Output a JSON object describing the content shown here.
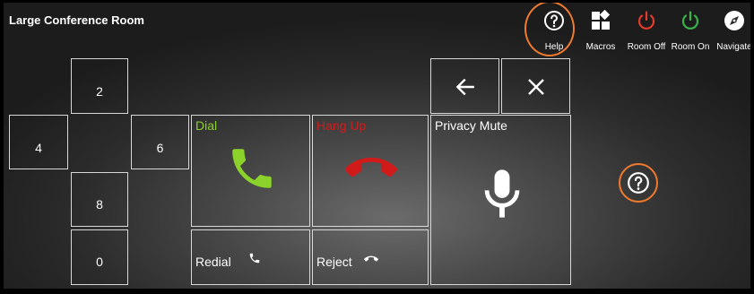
{
  "header": {
    "title": "Large Conference Room",
    "buttons": [
      {
        "label": "Help",
        "icon": "help-circle-icon"
      },
      {
        "label": "Macros",
        "icon": "macros-grid-icon"
      },
      {
        "label": "Room Off",
        "icon": "power-icon",
        "color": "#e23a2c"
      },
      {
        "label": "Room On",
        "icon": "power-icon",
        "color": "#38b44a"
      },
      {
        "label": "Navigate",
        "icon": "compass-icon"
      }
    ]
  },
  "keypad": {
    "keys": [
      "2",
      "4",
      "6",
      "8",
      "0"
    ]
  },
  "actions": {
    "back_icon": "arrow-left-icon",
    "clear_icon": "close-icon",
    "dial": {
      "label": "Dial",
      "color": "#8bd22a"
    },
    "hangup": {
      "label": "Hang Up",
      "color": "#d11b1b"
    },
    "privacy_mute": {
      "label": "Privacy Mute"
    },
    "redial": {
      "label": "Redial"
    },
    "reject": {
      "label": "Reject"
    }
  },
  "highlight_color": "#f07a2e"
}
